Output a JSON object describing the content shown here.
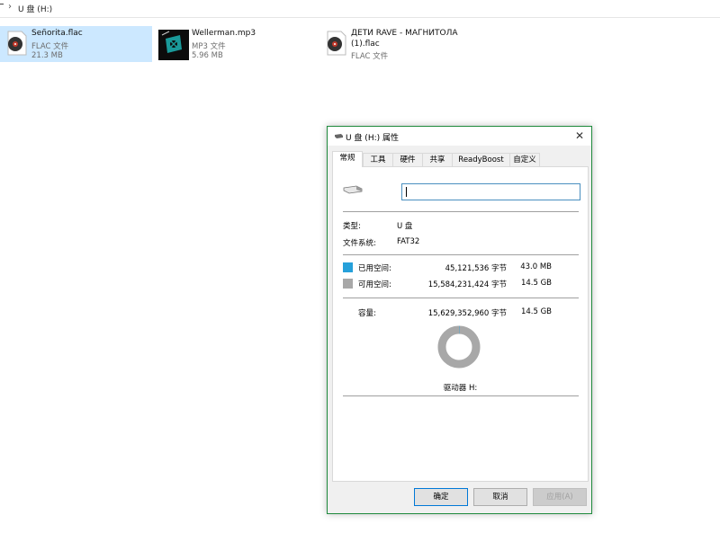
{
  "breadcrumb": {
    "location": "U 盘 (H:)"
  },
  "files": [
    {
      "name": "Señorita.flac",
      "type": "FLAC 文件",
      "size": "21.3 MB",
      "icon": "music-disc-icon"
    },
    {
      "name": "Wellerman.mp3",
      "type": "MP3 文件",
      "size": "5.96 MB",
      "icon": "album-cover-icon"
    },
    {
      "name_line1": "ДЕТИ RAVE - МАГНИТОЛА",
      "name_line2": "(1).flac",
      "type": "FLAC 文件",
      "icon": "music-disc-icon"
    }
  ],
  "dialog": {
    "title": "U 盘 (H:) 属性",
    "tabs": [
      "常规",
      "工具",
      "硬件",
      "共享",
      "ReadyBoost",
      "自定义"
    ],
    "active_tab": 0,
    "name_value": "",
    "type_label": "类型:",
    "type_value": "U 盘",
    "fs_label": "文件系统:",
    "fs_value": "FAT32",
    "used_label": "已用空间:",
    "used_bytes": "45,121,536 字节",
    "used_size": "43.0 MB",
    "free_label": "可用空间:",
    "free_bytes": "15,584,231,424 字节",
    "free_size": "14.5 GB",
    "capacity_label": "容量:",
    "capacity_bytes": "15,629,352,960 字节",
    "capacity_size": "14.5 GB",
    "drive_label": "驱动器 H:",
    "used_fraction": 0.0029,
    "buttons": {
      "ok": "确定",
      "cancel": "取消",
      "apply": "应用(A)"
    }
  },
  "colors": {
    "used": "#26a0da",
    "free": "#a8a8a8",
    "selection": "#cce8ff",
    "titlebar_border": "#1e8a3c"
  }
}
